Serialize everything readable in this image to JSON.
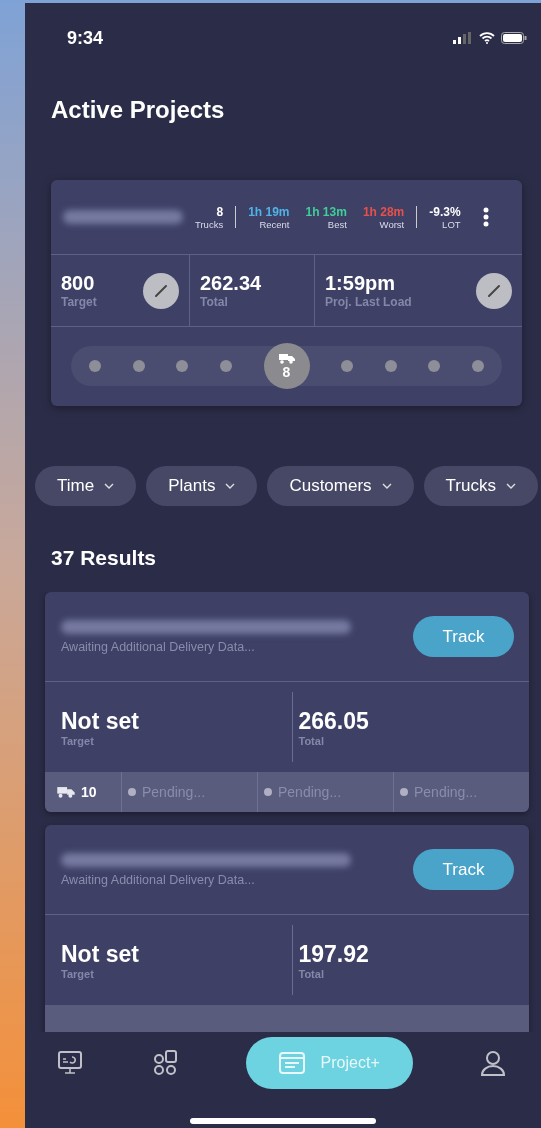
{
  "status_bar": {
    "time": "9:34"
  },
  "title": "Active Projects",
  "summary": {
    "trucks": {
      "value": "8",
      "label": "Trucks"
    },
    "times": [
      {
        "value": "1h 19m",
        "label": "Recent",
        "color": "#4fb3e8"
      },
      {
        "value": "1h 13m",
        "label": "Best",
        "color": "#3fcf9a"
      },
      {
        "value": "1h 28m",
        "label": "Worst",
        "color": "#e8504a"
      }
    ],
    "lot": {
      "value": "-9.3%",
      "label": "LOT"
    },
    "metrics": [
      {
        "value": "800",
        "label": "Target",
        "editable": true
      },
      {
        "value": "262.34",
        "label": "Total",
        "editable": false
      },
      {
        "value": "1:59pm",
        "label": "Proj. Last Load",
        "editable": true
      }
    ],
    "stops": [
      {
        "selected": false
      },
      {
        "selected": false
      },
      {
        "selected": false
      },
      {
        "selected": false
      },
      {
        "selected": true
      },
      {
        "selected": false
      },
      {
        "selected": false
      },
      {
        "selected": false
      },
      {
        "selected": false
      }
    ],
    "current_count": "8"
  },
  "filters": [
    "Time",
    "Plants",
    "Customers",
    "Trucks"
  ],
  "results_heading": "37 Results",
  "results": [
    {
      "status": "Awaiting Additional Delivery Data...",
      "action": "Track",
      "target": "Not set",
      "target_label": "Target",
      "total": "266.05",
      "total_label": "Total",
      "footer": {
        "trucks": "10",
        "slots": [
          "Pending...",
          "Pending...",
          "Pending..."
        ]
      }
    },
    {
      "status": "Awaiting Additional Delivery Data...",
      "action": "Track",
      "target": "Not set",
      "target_label": "Target",
      "total": "197.92",
      "total_label": "Total"
    }
  ],
  "nav": [
    {
      "kind": "monitor",
      "selected": false
    },
    {
      "kind": "apps",
      "selected": false
    },
    {
      "kind": "project",
      "label": "Project+",
      "selected": true
    },
    {
      "kind": "profile",
      "selected": false
    }
  ]
}
